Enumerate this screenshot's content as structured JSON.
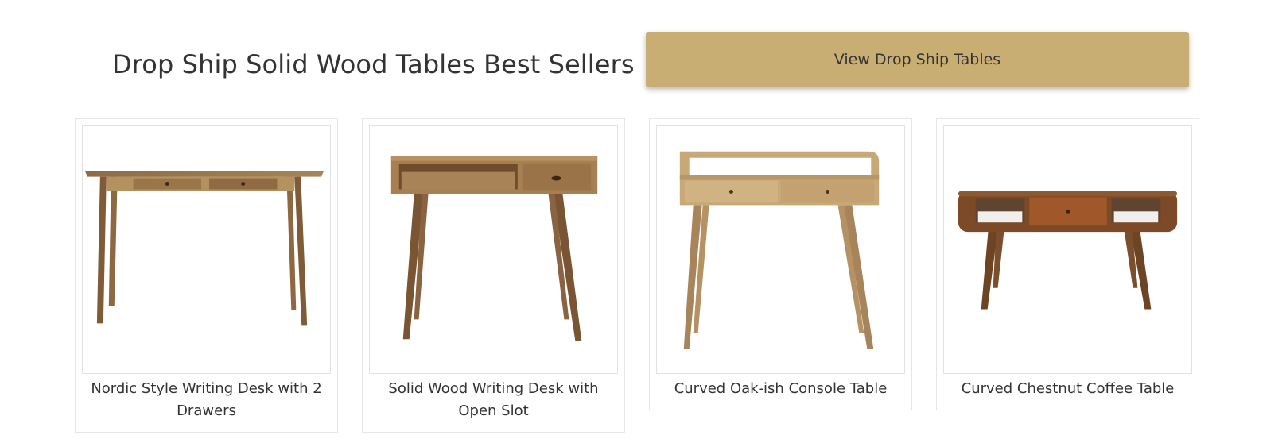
{
  "header": {
    "title": "Drop Ship Solid Wood Tables Best Sellers",
    "cta_label": "View Drop Ship Tables"
  },
  "colors": {
    "cta_background": "#c8ae73",
    "text": "#333333",
    "card_border": "#e6e6e6"
  },
  "products": [
    {
      "name": "Nordic Style Writing Desk with 2 Drawers",
      "image": "nordic-writing-desk-image"
    },
    {
      "name": "Solid Wood Writing Desk with Open Slot",
      "image": "open-slot-writing-desk-image"
    },
    {
      "name": "Curved Oak-ish Console Table",
      "image": "curved-console-table-image"
    },
    {
      "name": "Curved Chestnut Coffee Table",
      "image": "curved-coffee-table-image"
    }
  ]
}
